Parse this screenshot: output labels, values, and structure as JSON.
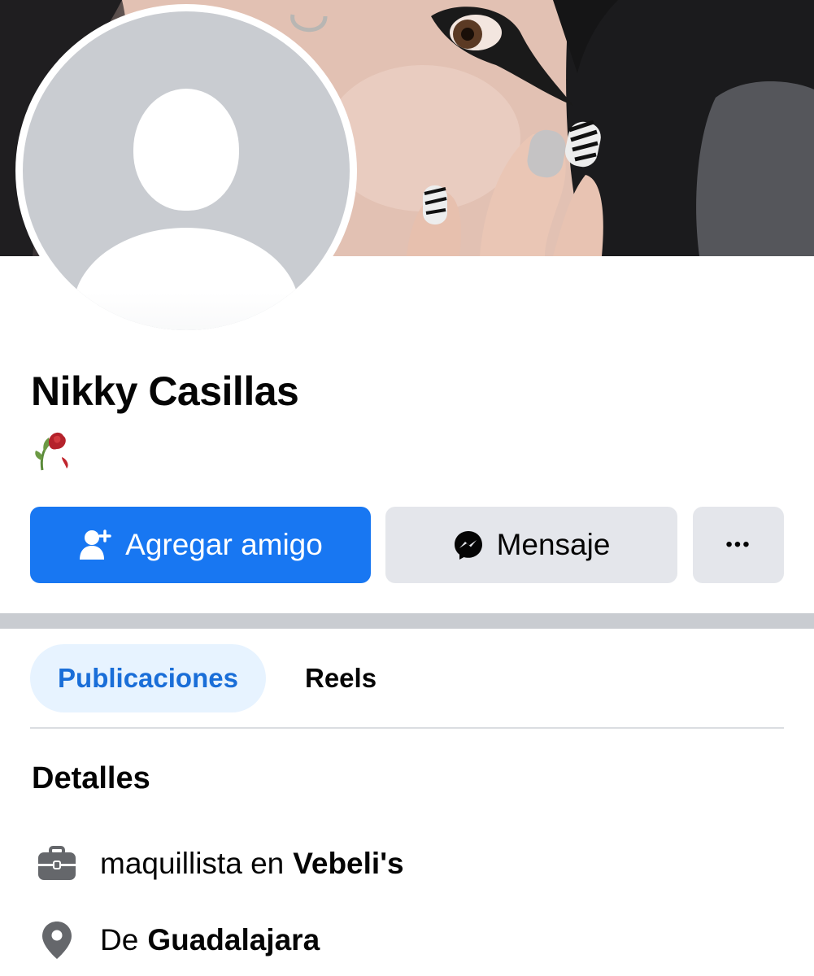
{
  "profile": {
    "name": "Nikky Casillas",
    "bio_emoji": "wilted-rose-emoji"
  },
  "actions": {
    "add_friend_label": "Agregar amigo",
    "message_label": "Mensaje",
    "more_label": "•••"
  },
  "tabs": [
    {
      "label": "Publicaciones",
      "active": true
    },
    {
      "label": "Reels",
      "active": false
    }
  ],
  "details": {
    "title": "Detalles",
    "work": {
      "prefix": "maquillista en",
      "place": "Vebeli's",
      "icon": "briefcase-icon"
    },
    "hometown": {
      "prefix": "De",
      "place": "Guadalajara",
      "icon": "location-pin-icon"
    }
  },
  "colors": {
    "primary": "#1877f2",
    "secondary_button": "#e4e6eb",
    "active_tab_bg": "#e7f3ff",
    "active_tab_text": "#1a6ed8",
    "divider": "#c9ccd1"
  }
}
